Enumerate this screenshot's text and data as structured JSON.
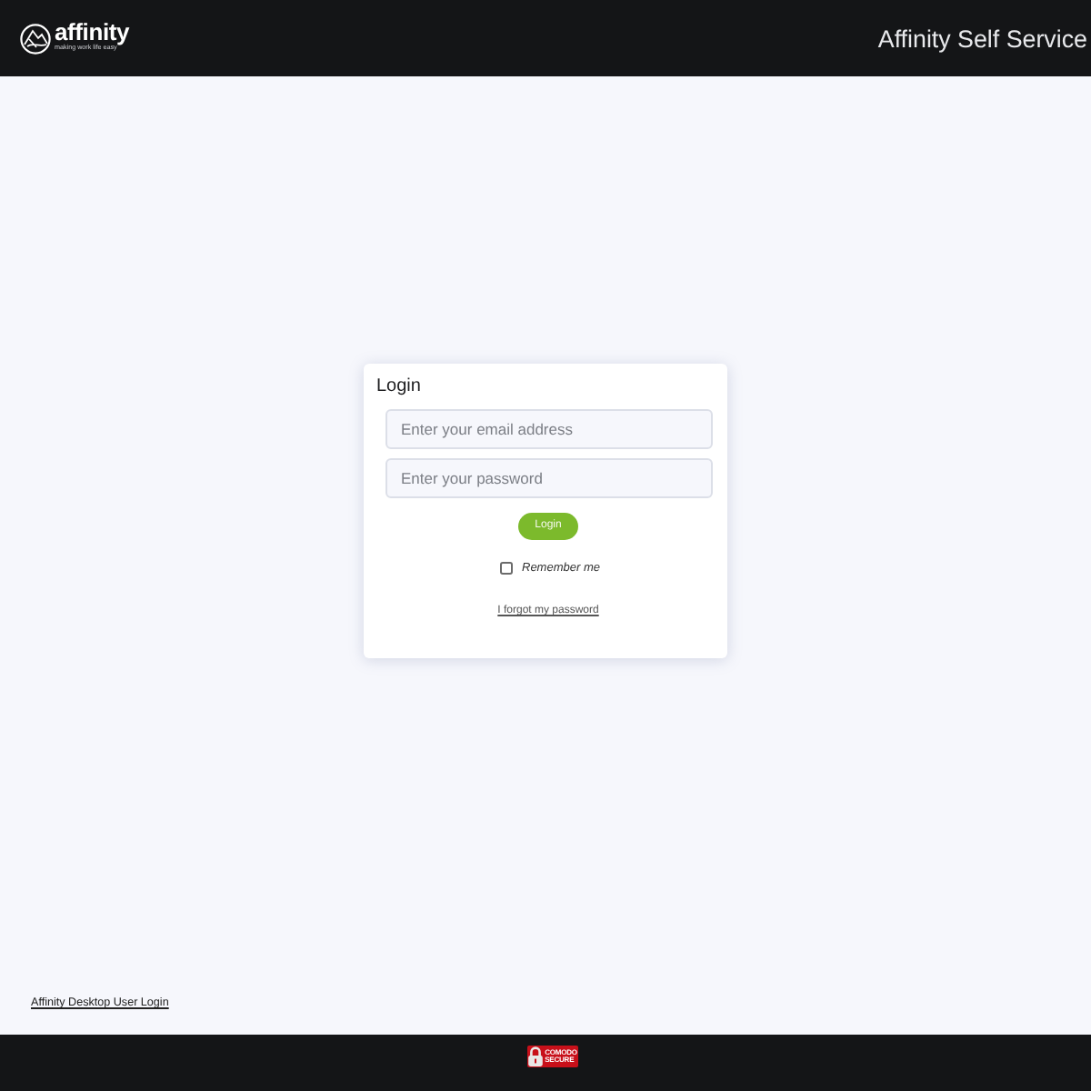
{
  "header": {
    "logo": {
      "wordmark": "affinity",
      "tagline": "making work life easy"
    },
    "title": "Affinity Self Service"
  },
  "login_card": {
    "title": "Login",
    "fields": [
      {
        "placeholder": "Enter your email address"
      },
      {
        "placeholder": "Enter your password"
      }
    ],
    "button": "Login",
    "remember_me": {
      "label": "Remember me",
      "checked": false
    },
    "forgot_link": "I forgot my password"
  },
  "desktop_link": "Affinity Desktop User Login",
  "footer": {
    "badge": {
      "line_1": "COMODO",
      "line_2": "SECURE"
    }
  }
}
